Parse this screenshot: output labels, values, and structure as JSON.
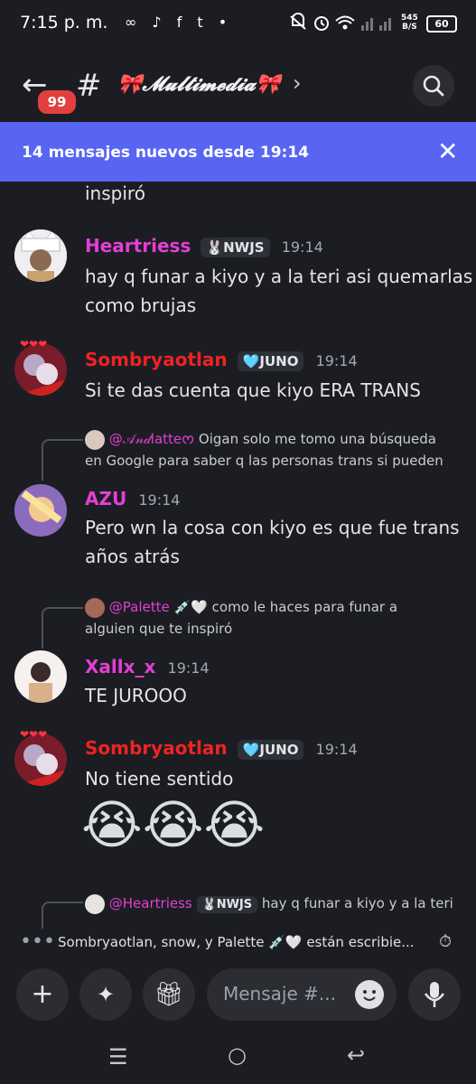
{
  "status_bar": {
    "time": "7:15 p. m.",
    "left_icons": "∞ ♪ f t •",
    "speed_value": "545",
    "speed_unit": "B/S",
    "battery": "60"
  },
  "header": {
    "badge": "99",
    "channel_name": "🎀𝓜𝓾𝓵𝓽𝓲𝓶𝓮𝓭𝓲𝓪🎀"
  },
  "banner": {
    "text": "14 mensajes nuevos desde 19:14"
  },
  "messages": [
    {
      "continuation": "inspiró"
    },
    {
      "user": "Heartriess",
      "tag": "NWJS",
      "tag_emoji": "🐰",
      "time": "19:14",
      "lines": [
        "hay q funar a kiyo y a la teri asi quemarlas",
        "como brujas"
      ]
    },
    {
      "user": "Sombryaotlan",
      "tag": "JUNO",
      "tag_emoji": "🩵",
      "time": "19:14",
      "lines": [
        "Si te das cuenta que kiyo ERA TRANS"
      ]
    },
    {
      "reply_user": "@𝒜𝓃𝒹latte",
      "reply_suffix": "ᰔ",
      "reply_text_1": "Oigan solo me tomo una búsqueda",
      "reply_text_2": "en Google para saber q las personas trans si pueden",
      "user": "AZU",
      "time": "19:14",
      "lines": [
        "Pero wn la cosa con kiyo es que fue trans",
        "años atrás"
      ]
    },
    {
      "reply_user": "@Palette",
      "reply_emoji": "💉🤍",
      "reply_text_1": "como le haces para funar a",
      "reply_text_2": "alguien que te inspiró",
      "user": "Xallx_x",
      "time": "19:14",
      "lines": [
        "TE JUROOO"
      ]
    },
    {
      "user": "Sombryaotlan",
      "tag": "JUNO",
      "tag_emoji": "🩵",
      "time": "19:14",
      "lines": [
        "No tiene sentido"
      ],
      "emojis": "😭😭😭"
    },
    {
      "reply_user": "@Heartriess",
      "reply_tag": "NWJS",
      "reply_tag_emoji": "🐰",
      "reply_text_1": "hay q funar a kiyo y a la teri"
    }
  ],
  "typing": {
    "text": "Sombryaotlan, snow, y Palette 💉🤍 están escribie..."
  },
  "input": {
    "placeholder": "Mensaje #..."
  },
  "colors": {
    "accent": "#5865f2",
    "pink": "#e33fd5",
    "red": "#ef2323",
    "background": "#1c1d22"
  }
}
